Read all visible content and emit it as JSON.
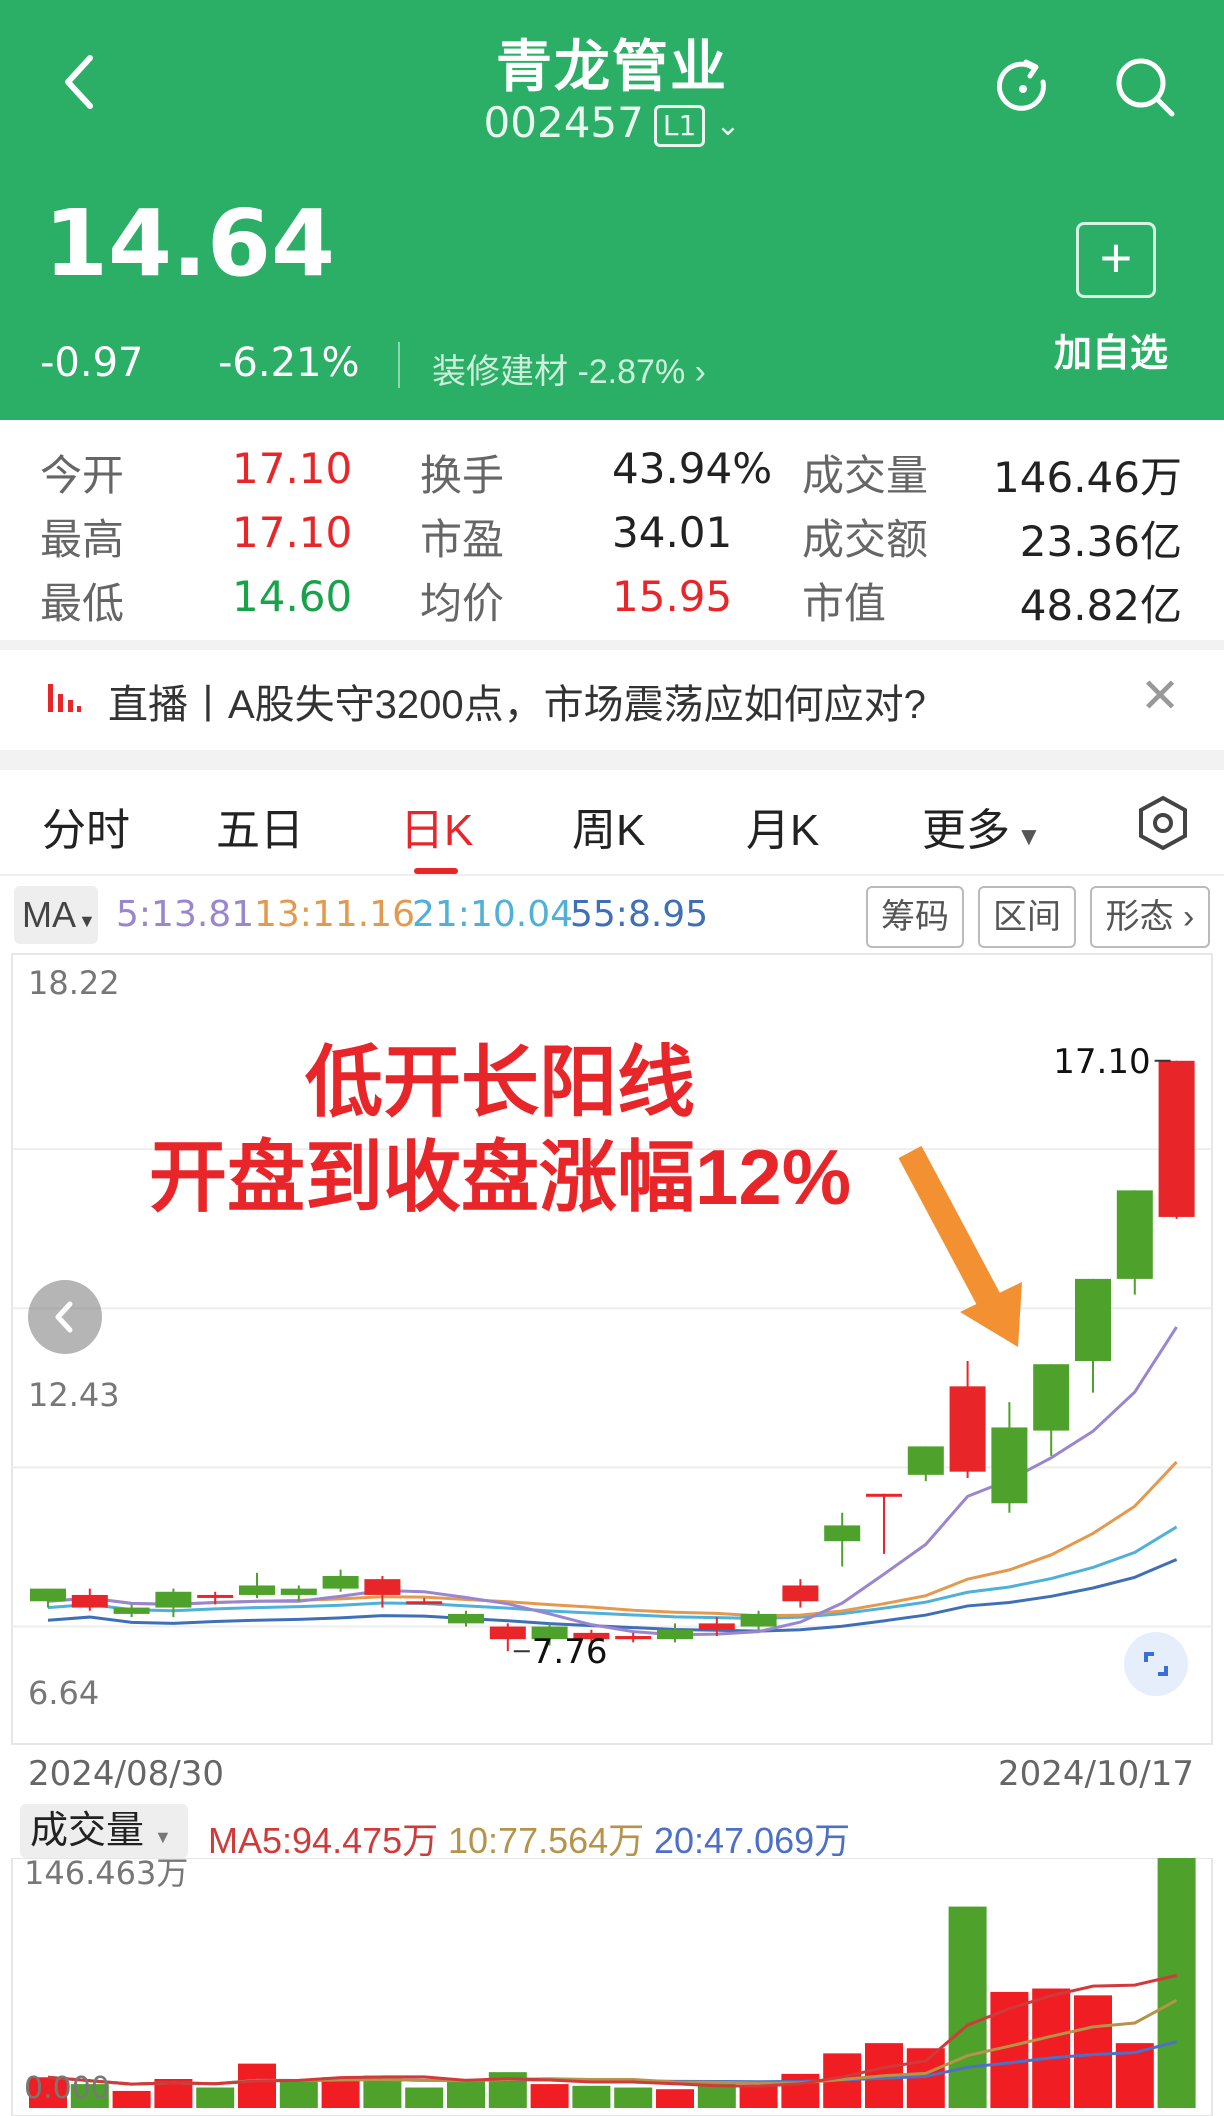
{
  "header": {
    "title": "青龙管业",
    "code": "002457",
    "level": "L1",
    "price": "14.64",
    "change": "-0.97",
    "change_pct": "-6.21%",
    "sector": "装修建材 -2.87% ›",
    "add_label": "加自选",
    "back_icon": "chevron-left-icon",
    "refresh_icon": "refresh-icon",
    "search_icon": "search-icon"
  },
  "stats": [
    {
      "label": "今开",
      "value": "17.10",
      "color": "red"
    },
    {
      "label": "最高",
      "value": "17.10",
      "color": "red"
    },
    {
      "label": "最低",
      "value": "14.60",
      "color": "green"
    },
    {
      "label": "换手",
      "value": "43.94%",
      "color": "plain"
    },
    {
      "label": "市盈",
      "value": "34.01",
      "color": "plain"
    },
    {
      "label": "均价",
      "value": "15.95",
      "color": "red"
    },
    {
      "label": "成交量",
      "value": "146.46万",
      "color": "plain"
    },
    {
      "label": "成交额",
      "value": "23.36亿",
      "color": "plain"
    },
    {
      "label": "市值",
      "value": "48.82亿",
      "color": "plain"
    }
  ],
  "news": {
    "text": "直播丨A股失守3200点，市场震荡应如何应对?"
  },
  "tabs": [
    "分时",
    "五日",
    "日K",
    "周K",
    "月K",
    "更多"
  ],
  "active_tab": "日K",
  "ma": {
    "label": "MA",
    "ma5": "5:13.81",
    "ma13": "13:11.16",
    "ma21": "21:10.04",
    "ma55": "55:8.95",
    "colors": {
      "ma5": "#9a86cf",
      "ma13": "#e39a4f",
      "ma21": "#4fb0d9",
      "ma55": "#3f6fb6"
    }
  },
  "tools": [
    "筹码",
    "区间",
    "形态 ›"
  ],
  "annotation": {
    "line1": "低开长阳线",
    "line2": "开盘到收盘涨幅12%"
  },
  "chart_data": {
    "type": "candlestick",
    "y_axis_labels": [
      "18.22",
      "12.43",
      "6.64"
    ],
    "ylim": [
      6.64,
      18.22
    ],
    "max_label": "17.10",
    "min_label": "7.76",
    "x_start": "2024/08/30",
    "x_end": "2024/10/17",
    "candles": [
      {
        "o": 8.75,
        "c": 8.55,
        "h": 8.75,
        "l": 8.45
      },
      {
        "o": 8.45,
        "c": 8.65,
        "h": 8.75,
        "l": 8.4
      },
      {
        "o": 8.45,
        "c": 8.35,
        "h": 8.5,
        "l": 8.3
      },
      {
        "o": 8.7,
        "c": 8.45,
        "h": 8.75,
        "l": 8.3
      },
      {
        "o": 8.65,
        "c": 8.65,
        "h": 8.7,
        "l": 8.5
      },
      {
        "o": 8.8,
        "c": 8.65,
        "h": 9.0,
        "l": 8.6
      },
      {
        "o": 8.75,
        "c": 8.65,
        "h": 8.8,
        "l": 8.55
      },
      {
        "o": 8.95,
        "c": 8.75,
        "h": 9.05,
        "l": 8.7
      },
      {
        "o": 8.65,
        "c": 8.9,
        "h": 8.95,
        "l": 8.45
      },
      {
        "o": 8.55,
        "c": 8.55,
        "h": 8.6,
        "l": 8.5
      },
      {
        "o": 8.35,
        "c": 8.2,
        "h": 8.4,
        "l": 8.15
      },
      {
        "o": 7.95,
        "c": 8.15,
        "h": 8.2,
        "l": 7.76
      },
      {
        "o": 8.15,
        "c": 7.95,
        "h": 8.2,
        "l": 7.85
      },
      {
        "o": 7.95,
        "c": 8.05,
        "h": 8.1,
        "l": 7.9
      },
      {
        "o": 7.95,
        "c": 8.0,
        "h": 8.05,
        "l": 7.9
      },
      {
        "o": 8.1,
        "c": 7.95,
        "h": 8.2,
        "l": 7.9
      },
      {
        "o": 8.1,
        "c": 8.2,
        "h": 8.3,
        "l": 8.0
      },
      {
        "o": 8.35,
        "c": 8.15,
        "h": 8.4,
        "l": 8.1
      },
      {
        "o": 8.55,
        "c": 8.8,
        "h": 8.9,
        "l": 8.45
      },
      {
        "o": 9.75,
        "c": 9.5,
        "h": 9.95,
        "l": 9.1
      },
      {
        "o": 10.25,
        "c": 10.25,
        "h": 10.25,
        "l": 9.3
      },
      {
        "o": 11.0,
        "c": 10.55,
        "h": 11.0,
        "l": 10.45
      },
      {
        "o": 10.6,
        "c": 11.95,
        "h": 12.35,
        "l": 10.5
      },
      {
        "o": 11.3,
        "c": 10.1,
        "h": 11.7,
        "l": 9.95
      },
      {
        "o": 12.3,
        "c": 11.25,
        "h": 12.3,
        "l": 10.85
      },
      {
        "o": 13.65,
        "c": 12.35,
        "h": 13.65,
        "l": 11.85
      },
      {
        "o": 15.05,
        "c": 13.65,
        "h": 15.05,
        "l": 13.4
      },
      {
        "o": 14.63,
        "c": 17.1,
        "h": 17.1,
        "l": 14.6
      }
    ]
  },
  "volume": {
    "label": "成交量",
    "ma5": "MA5:94.475万",
    "ma10": "10:77.564万",
    "ma20": "20:47.069万",
    "max_label": "146.463万",
    "min_label": "0.000",
    "colors": {
      "ma5": "#d13a3a",
      "ma10": "#b5934a",
      "ma20": "#4d6fc8"
    },
    "bars": [
      {
        "v": 18,
        "up": true
      },
      {
        "v": 14,
        "up": false
      },
      {
        "v": 10,
        "up": true
      },
      {
        "v": 17,
        "up": true
      },
      {
        "v": 12,
        "up": false
      },
      {
        "v": 26,
        "up": true
      },
      {
        "v": 16,
        "up": false
      },
      {
        "v": 18,
        "up": true
      },
      {
        "v": 19,
        "up": false
      },
      {
        "v": 12,
        "up": false
      },
      {
        "v": 16,
        "up": false
      },
      {
        "v": 21,
        "up": false
      },
      {
        "v": 14,
        "up": true
      },
      {
        "v": 13,
        "up": false
      },
      {
        "v": 12,
        "up": false
      },
      {
        "v": 11,
        "up": true
      },
      {
        "v": 15,
        "up": false
      },
      {
        "v": 13,
        "up": true
      },
      {
        "v": 20,
        "up": true
      },
      {
        "v": 32,
        "up": true
      },
      {
        "v": 38,
        "up": true
      },
      {
        "v": 35,
        "up": true
      },
      {
        "v": 118,
        "up": false
      },
      {
        "v": 68,
        "up": true
      },
      {
        "v": 70,
        "up": true
      },
      {
        "v": 66,
        "up": true
      },
      {
        "v": 38,
        "up": true
      },
      {
        "v": 146.463,
        "up": false
      }
    ]
  }
}
